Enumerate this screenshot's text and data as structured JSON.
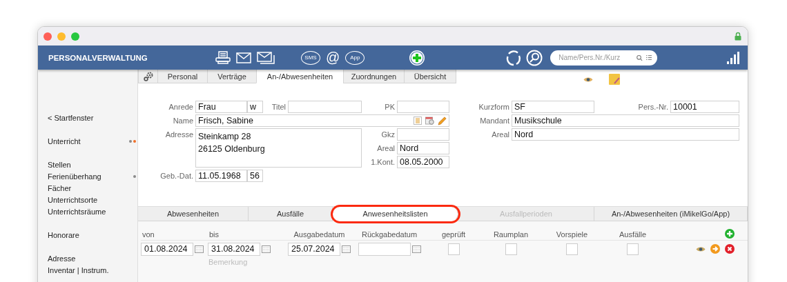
{
  "window": {
    "secure": true
  },
  "header": {
    "title": "PERSONALVERWALTUNG",
    "message_buttons": [
      {
        "label": "SMS"
      },
      {
        "label": "@"
      },
      {
        "label": "App"
      }
    ],
    "search": {
      "placeholder": "Name/Pers.Nr./Kurz"
    }
  },
  "sidebar": {
    "groups": [
      [
        {
          "label": "< Startfenster"
        }
      ],
      [
        {
          "label": "Unterricht",
          "markers": [
            {
              "color": "#8a8a8a"
            },
            {
              "color": "#f0702a"
            }
          ]
        }
      ],
      [
        {
          "label": "Stellen"
        },
        {
          "label": "Ferienüberhang",
          "markers": [
            {
              "color": "#8a8a8a"
            }
          ]
        },
        {
          "label": "Fächer"
        },
        {
          "label": "Unterrichtsorte"
        },
        {
          "label": "Unterrichtsräume"
        }
      ],
      [
        {
          "label": "Honorare"
        }
      ],
      [
        {
          "label": "Adresse"
        },
        {
          "label": "Inventar | Instrum."
        }
      ]
    ]
  },
  "tabs": [
    {
      "label": "Personal",
      "selected": false
    },
    {
      "label": "Verträge",
      "selected": false
    },
    {
      "label": "An-/Abwesenheiten",
      "selected": true
    },
    {
      "label": "Zuordnungen",
      "selected": false
    },
    {
      "label": "Übersicht",
      "selected": false
    }
  ],
  "form": {
    "anrede": {
      "label": "Anrede",
      "value": "Frau",
      "gender": "w"
    },
    "titel": {
      "label": "Titel"
    },
    "pk": {
      "label": "PK"
    },
    "name": {
      "label": "Name",
      "value": "Frisch, Sabine"
    },
    "adresse": {
      "label": "Adresse",
      "lines": [
        "Steinkamp 28",
        "26125 Oldenburg"
      ]
    },
    "gkz": {
      "label": "Gkz"
    },
    "areal": {
      "label": "Areal",
      "value": "Nord"
    },
    "kontakt": {
      "label": "1.Kont.",
      "value": "08.05.2000"
    },
    "geburt": {
      "label": "Geb.-Dat.",
      "value": "11.05.1968",
      "age": "56"
    },
    "kurzform": {
      "label": "Kurzform",
      "value": "SF"
    },
    "pers_nr": {
      "label": "Pers.-Nr.",
      "value": "10001"
    },
    "mandant": {
      "label": "Mandant",
      "value": "Musikschule"
    },
    "areal_2": {
      "label": "Areal",
      "value": "Nord"
    }
  },
  "subtabs": [
    {
      "label": "Abwesenheiten",
      "selected": false,
      "disabled": false,
      "highlighted": false
    },
    {
      "label": "Ausfälle",
      "selected": false,
      "disabled": false,
      "highlighted": false
    },
    {
      "label": "Anwesenheitslisten",
      "selected": true,
      "disabled": false,
      "highlighted": true
    },
    {
      "label": "Ausfallperioden",
      "selected": false,
      "disabled": true,
      "highlighted": false
    },
    {
      "label": "An-/Abwesenheiten (iMikelGo/App)",
      "selected": false,
      "disabled": false,
      "highlighted": false
    }
  ],
  "list": {
    "columns": [
      {
        "label": "von",
        "kind": "date"
      },
      {
        "label": "bis",
        "kind": "date"
      },
      {
        "label": "Ausgabedatum",
        "kind": "date"
      },
      {
        "label": "Rückgabedatum",
        "kind": "date"
      },
      {
        "label": "geprüft",
        "kind": "check"
      },
      {
        "label": "Raumplan",
        "kind": "check"
      },
      {
        "label": "Vorspiele",
        "kind": "check"
      },
      {
        "label": "Ausfälle",
        "kind": "check"
      }
    ],
    "rows": [
      {
        "cells": [
          {
            "kind": "date",
            "value": "01.08.2024"
          },
          {
            "kind": "date",
            "value": "31.08.2024"
          },
          {
            "kind": "date",
            "value": "25.07.2024"
          },
          {
            "kind": "date"
          },
          {
            "kind": "check",
            "checked": false
          },
          {
            "kind": "check",
            "checked": false
          },
          {
            "kind": "check",
            "checked": false
          },
          {
            "kind": "check",
            "checked": false
          }
        ],
        "remark_placeholder": "Bemerkung"
      }
    ]
  }
}
